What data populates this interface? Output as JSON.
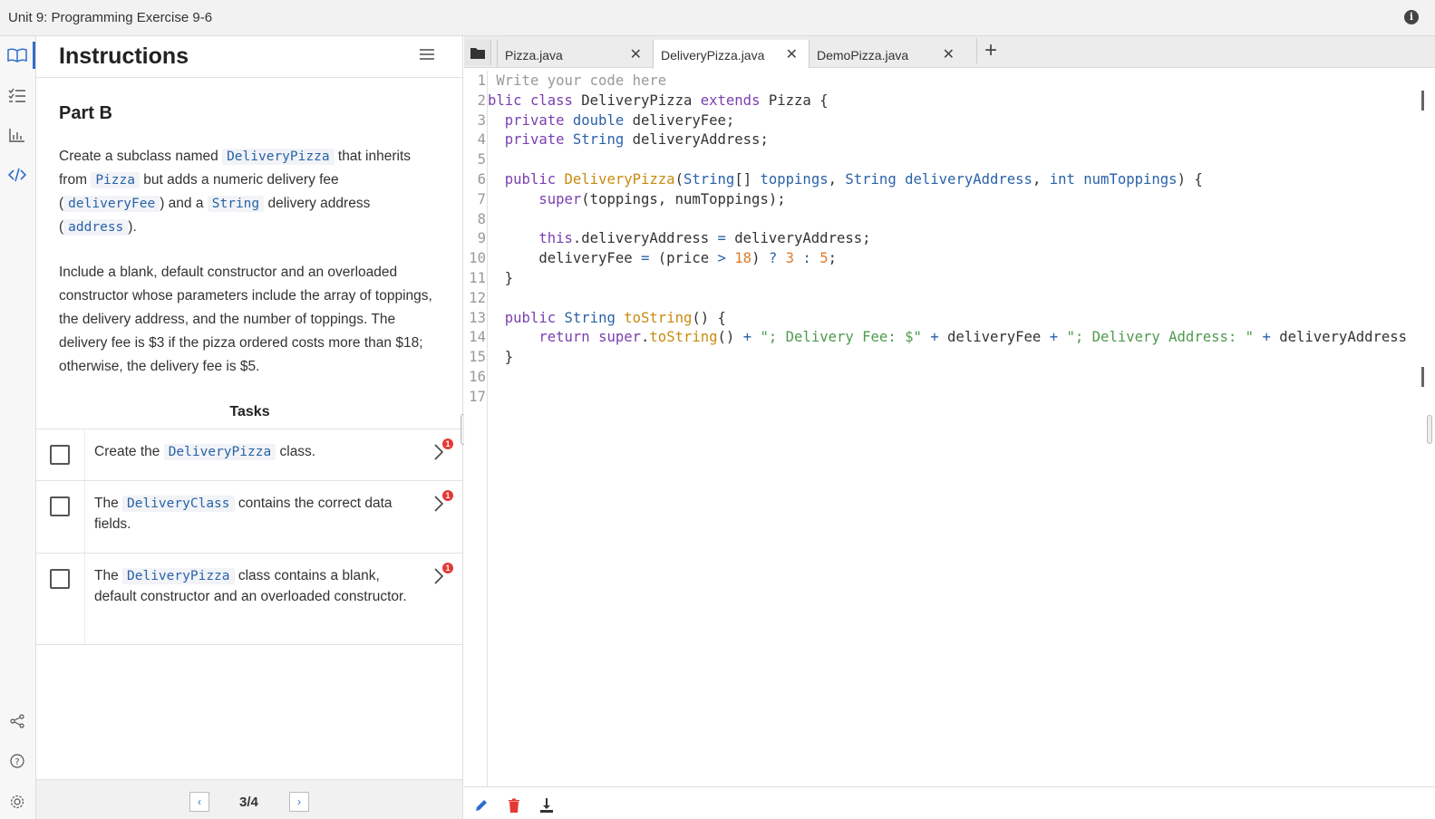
{
  "window": {
    "title": "Unit 9: Programming Exercise 9-6"
  },
  "rail": {
    "icons": [
      "book-icon",
      "checklist-icon",
      "chart-icon",
      "code-icon",
      "share-icon",
      "help-icon",
      "settings-icon"
    ]
  },
  "instructions": {
    "header": "Instructions",
    "section": "Part B",
    "p1": {
      "a": "Create a subclass named ",
      "c1": "DeliveryPizza",
      "b": " that inherits from ",
      "c2": "Pizza",
      "c": " but adds a numeric delivery fee (",
      "c3": "deliveryFee",
      "d": ") and a ",
      "c4": "String",
      "e": " delivery address (",
      "c5": "address",
      "f": ")."
    },
    "p2": "Include a blank, default constructor and an overloaded constructor whose parameters include the array of toppings, the delivery address, and the number of toppings. The delivery fee is $3 if the pizza ordered costs more than $18; otherwise, the delivery fee is $5.",
    "tasks_title": "Tasks",
    "tasks": [
      {
        "pre": "Create the ",
        "code": "DeliveryPizza",
        "post": " class.",
        "badge": "1"
      },
      {
        "pre": "The ",
        "code": "DeliveryClass",
        "post": " contains the correct data fields.",
        "badge": "1"
      },
      {
        "pre": "The ",
        "code": "DeliveryPizza",
        "post": " class contains a blank, default constructor and an overloaded constructor.",
        "badge": "1"
      }
    ],
    "pager": {
      "prev": "‹",
      "page": "3/4",
      "next": "›"
    }
  },
  "editor": {
    "tabs": [
      {
        "label": "Pizza.java",
        "close": "✕"
      },
      {
        "label": "DeliveryPizza.java",
        "close": "✕"
      },
      {
        "label": "DemoPizza.java",
        "close": "✕"
      }
    ],
    "add_tab": "+",
    "line_numbers": [
      "1",
      "2",
      "3",
      "4",
      "5",
      "6",
      "7",
      "8",
      "9",
      "10",
      "11",
      "12",
      "13",
      "14",
      "15",
      "16",
      "17"
    ],
    "code_lines": [
      " Write your code here",
      "blic class DeliveryPizza extends Pizza {",
      "  private double deliveryFee;",
      "  private String deliveryAddress;",
      "",
      "  public DeliveryPizza(String[] toppings, String deliveryAddress, int numToppings) {",
      "      super(toppings, numToppings);",
      "",
      "      this.deliveryAddress = deliveryAddress;",
      "      deliveryFee = (price > 18) ? 3 : 5;",
      "  }",
      "",
      "  public String toString() {",
      "      return super.toString() + \"; Delivery Fee: $\" + deliveryFee + \"; Delivery Address: \" + deliveryAddress",
      "  }",
      "",
      ""
    ],
    "bottom_icons": [
      "pencil-icon",
      "trash-icon",
      "download-icon"
    ]
  },
  "colors": {
    "accent": "#2f6dcb",
    "badge": "#e53935",
    "keyword": "#7a3fb0",
    "type": "#2a62a8",
    "string": "#4f9a4f",
    "number": "#e07b2a",
    "method": "#c98a0f"
  }
}
